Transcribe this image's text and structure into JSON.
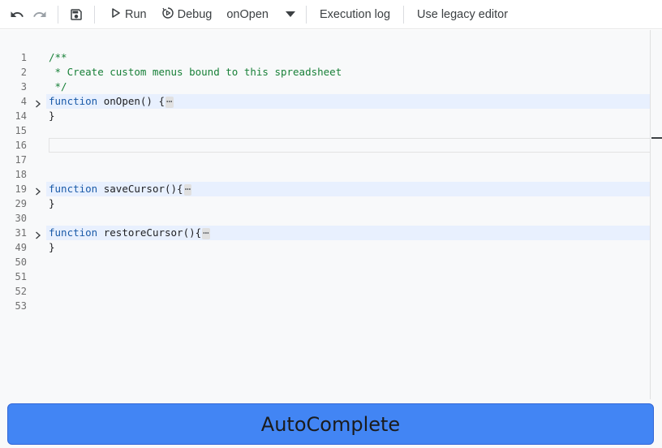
{
  "toolbar": {
    "run_label": "Run",
    "debug_label": "Debug",
    "function_select": "onOpen",
    "execution_log_label": "Execution log",
    "legacy_editor_label": "Use legacy editor"
  },
  "editor": {
    "lines": [
      {
        "num": "1",
        "text": "/**"
      },
      {
        "num": "2",
        "text": " * Create custom menus bound to this spreadsheet"
      },
      {
        "num": "3",
        "text": " */"
      },
      {
        "num": "4",
        "keyword": "function",
        "text": " onOpen() {"
      },
      {
        "num": "14",
        "text": "}"
      },
      {
        "num": "15",
        "text": ""
      },
      {
        "num": "16",
        "text": ""
      },
      {
        "num": "17",
        "text": ""
      },
      {
        "num": "18",
        "text": ""
      },
      {
        "num": "19",
        "keyword": "function",
        "text": " saveCursor(){"
      },
      {
        "num": "29",
        "text": "}"
      },
      {
        "num": "30",
        "text": ""
      },
      {
        "num": "31",
        "keyword": "function",
        "text": " restoreCursor(){"
      },
      {
        "num": "49",
        "text": "}"
      },
      {
        "num": "50",
        "text": ""
      },
      {
        "num": "51",
        "text": ""
      },
      {
        "num": "52",
        "text": ""
      },
      {
        "num": "53",
        "text": ""
      }
    ],
    "fold_ellipsis": "⋯"
  },
  "banner": {
    "label": "AutoComplete"
  },
  "colors": {
    "banner": "#4285f4",
    "fold_highlight": "#e8f0fe",
    "comment": "#188038",
    "keyword": "#1a5aa8"
  },
  "icons": [
    "undo-icon",
    "redo-icon",
    "save-icon",
    "play-icon",
    "debug-icon",
    "dropdown-arrow-icon",
    "chevron-right-icon"
  ]
}
